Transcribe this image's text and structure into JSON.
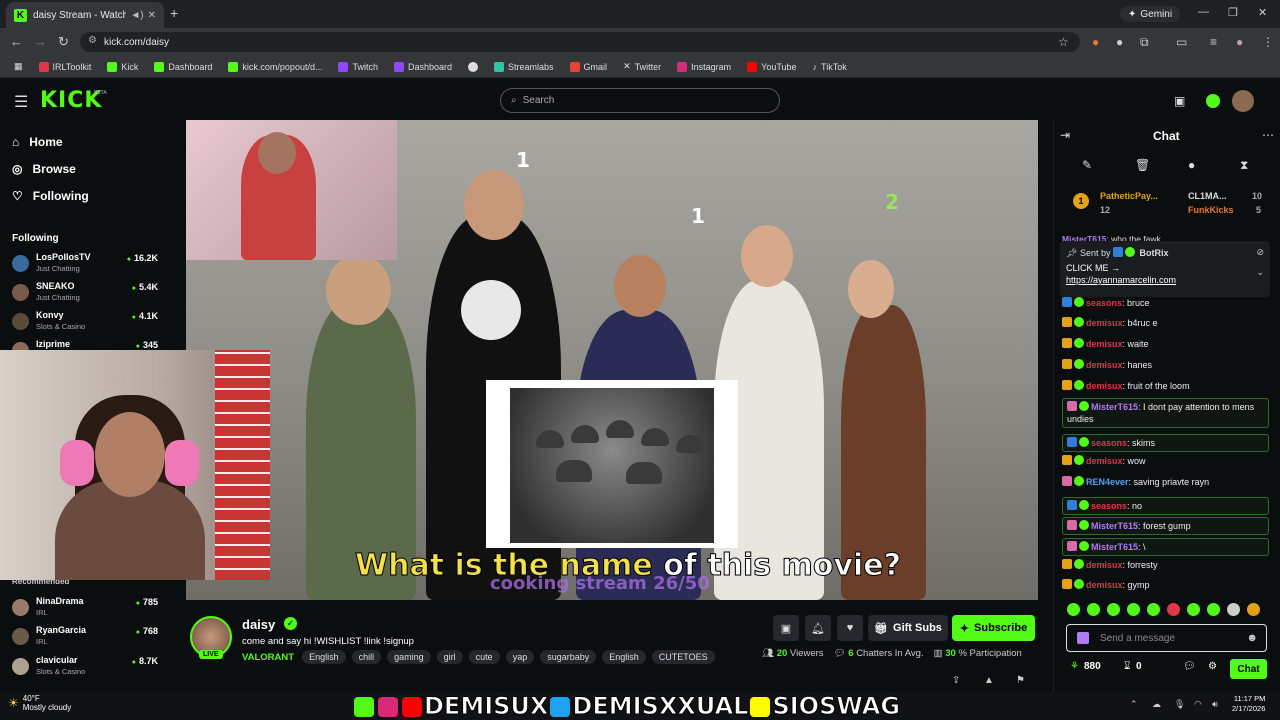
{
  "browser": {
    "tab_title": "daisy Stream - Watch Live o",
    "url": "kick.com/daisy",
    "gemini_label": "Gemini",
    "bookmarks": [
      {
        "label": "IRLToolkit",
        "color": "#e0364b"
      },
      {
        "label": "Kick",
        "color": "#53fc18"
      },
      {
        "label": "Dashboard",
        "color": "#53fc18"
      },
      {
        "label": "kick.com/popout/d...",
        "color": "#53fc18"
      },
      {
        "label": "Twitch",
        "color": "#9146ff"
      },
      {
        "label": "Dashboard",
        "color": "#9146ff"
      },
      {
        "label": "",
        "color": "#dddddd"
      },
      {
        "label": "Streamlabs",
        "color": "#31c3a2"
      },
      {
        "label": "Gmail",
        "color": "#ea4335"
      },
      {
        "label": "Twitter",
        "color": "#ffffff"
      },
      {
        "label": "Instagram",
        "color": "#d62976"
      },
      {
        "label": "YouTube",
        "color": "#ff0000"
      },
      {
        "label": "TikTok",
        "color": "#ffffff"
      }
    ]
  },
  "kick": {
    "logo": "KICK",
    "beta": "BETA",
    "search_placeholder": "Search"
  },
  "sidebar": {
    "nav": [
      {
        "label": "Home",
        "icon": "home-icon"
      },
      {
        "label": "Browse",
        "icon": "compass-icon"
      },
      {
        "label": "Following",
        "icon": "heart-icon"
      }
    ],
    "following_heading": "Following",
    "following": [
      {
        "name": "LosPollosTV",
        "category": "Just Chatting",
        "viewers": "16.2K"
      },
      {
        "name": "SNEAKO",
        "category": "Just Chatting",
        "viewers": "5.4K"
      },
      {
        "name": "Konvy",
        "category": "Slots & Casino",
        "viewers": "4.1K"
      },
      {
        "name": "Iziprime",
        "category": "",
        "viewers": "345"
      }
    ],
    "recommended_heading": "Recommended",
    "recommended": [
      {
        "name": "NinaDrama",
        "category": "IRL",
        "viewers": "785"
      },
      {
        "name": "RyanGarcia",
        "category": "IRL",
        "viewers": "768"
      },
      {
        "name": "clavicular",
        "category": "Slots & Casino",
        "viewers": "8.7K"
      }
    ]
  },
  "video": {
    "caption_yellow": "What is the name",
    "caption_white": " of this movie?",
    "overlay_text": "cooking stream 26/50",
    "numbers": [
      "1",
      "1",
      "2"
    ]
  },
  "stream": {
    "name": "daisy",
    "live": "LIVE",
    "title": "come and say hi !WISHLIST !link !signup",
    "category": "VALORANT",
    "tags": [
      "English",
      "chill",
      "gaming",
      "girl",
      "cute",
      "yap",
      "sugarbaby",
      "English",
      "CUTETOES"
    ],
    "gift_subs": "Gift Subs",
    "subscribe": "Subscribe",
    "viewers_value": "20",
    "viewers_label": "Viewers",
    "chatters_value": "6",
    "chatters_label": "Chatters In Avg.",
    "participation_value": "30",
    "participation_label": "% Participation"
  },
  "chat": {
    "header": "Chat",
    "leaderboard": [
      {
        "name": "PatheticPay...",
        "value": "12"
      },
      {
        "name": "CL1MA...",
        "value": "10"
      },
      {
        "name": "FunkKicks",
        "value": "5"
      }
    ],
    "leader_rank": "1",
    "pinned": {
      "sent_by_label": "Sent by",
      "sender": "BotRix",
      "line1": "CLICK ME →",
      "link": "https://ayannamarcelin.com",
      "behind_user": "MisterT615",
      "behind_text": "who the fawk"
    },
    "messages": [
      {
        "user": "seasons",
        "text": "bruce",
        "color": "u-red",
        "badge": "blue",
        "hl": false
      },
      {
        "user": "demisux",
        "text": "b4ruc e",
        "color": "u-red",
        "badge": "crown",
        "hl": false
      },
      {
        "user": "demisux",
        "text": "waite",
        "color": "u-red",
        "badge": "crown",
        "hl": false
      },
      {
        "user": "demisux",
        "text": "hanes",
        "color": "u-red",
        "badge": "crown",
        "hl": false
      },
      {
        "user": "demisux",
        "text": "fruit of the loom",
        "color": "u-red",
        "badge": "crown",
        "hl": false
      },
      {
        "user": "MisterT615",
        "text": "I dont pay attention to mens undies",
        "color": "u-purple",
        "badge": "pink",
        "hl": true
      },
      {
        "user": "seasons",
        "text": "skims",
        "color": "u-red",
        "badge": "blue",
        "hl": true
      },
      {
        "user": "demisux",
        "text": "wow",
        "color": "u-red",
        "badge": "crown",
        "hl": false
      },
      {
        "user": "REN4ever",
        "text": "saving priavte rayn",
        "color": "u-blue",
        "badge": "pink",
        "hl": false
      },
      {
        "user": "seasons",
        "text": "no",
        "color": "u-red",
        "badge": "blue",
        "hl": true
      },
      {
        "user": "MisterT615",
        "text": "forest gump",
        "color": "u-purple",
        "badge": "pink",
        "hl": true
      },
      {
        "user": "MisterT615",
        "text": "\\",
        "color": "u-purple",
        "badge": "pink",
        "hl": true
      },
      {
        "user": "demisux",
        "text": "forresty",
        "color": "u-red",
        "badge": "crown",
        "hl": false
      },
      {
        "user": "demisux",
        "text": "gymp",
        "color": "u-red",
        "badge": "crown",
        "hl": false
      }
    ],
    "input_placeholder": "Send a message",
    "points": "880",
    "count": "0",
    "send_button": "Chat"
  },
  "banner": {
    "text1": "DEMISUX",
    "text2": "DEMISXXUAL",
    "text3": "SIOSWAG"
  },
  "taskbar": {
    "temp": "40°F",
    "weather": "Mostly cloudy",
    "time": "11:17 PM",
    "date": "2/17/2026"
  }
}
